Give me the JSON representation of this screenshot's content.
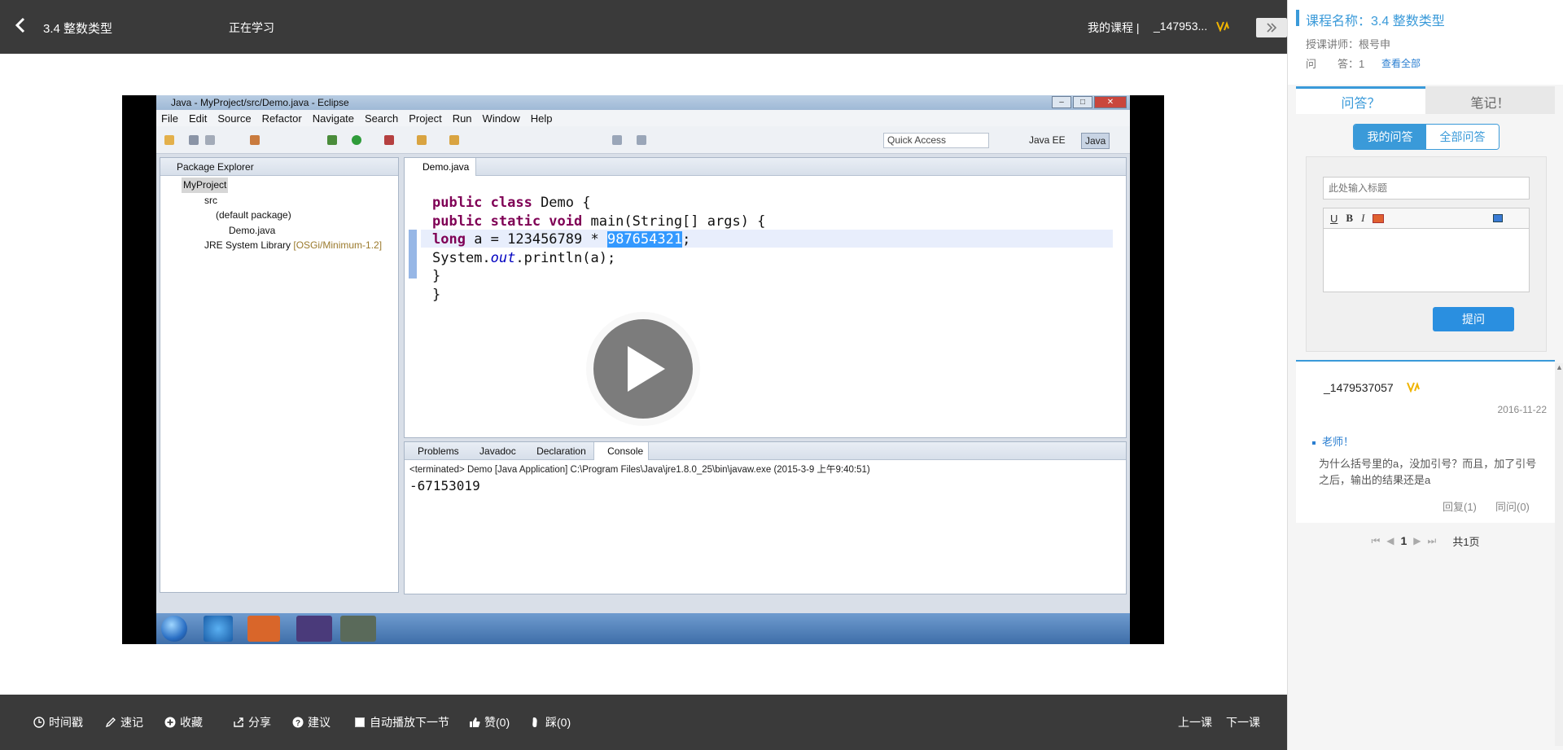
{
  "topbar": {
    "lesson_title": "3.4 整数类型",
    "status": "正在学习",
    "my_course": "我的课程 |",
    "username": "_147953..."
  },
  "video": {
    "eclipse_title": "Java - MyProject/src/Demo.java - Eclipse",
    "menu": [
      "File",
      "Edit",
      "Source",
      "Refactor",
      "Navigate",
      "Search",
      "Project",
      "Run",
      "Window",
      "Help"
    ],
    "quick_access": "Quick Access",
    "perspectives": [
      "Java EE",
      "Java"
    ],
    "package_explorer_title": "Package Explorer",
    "tree": {
      "project": "MyProject",
      "src": "src",
      "package": "(default package)",
      "file": "Demo.java",
      "jre": "JRE System Library",
      "jre_version": "[OSGi/Minimum-1.2]"
    },
    "editor_tab": "Demo.java",
    "code": {
      "line1_kw": "public class",
      "line1_rest": " Demo {",
      "line2_kw": "public static void",
      "line2_rest": " main(String[] args) {",
      "line3_kw": "long",
      "line3_mid": " a = 123456789 * ",
      "line3_sel": "987654321",
      "line3_end": ";",
      "line4_a": "System.",
      "line4_out": "out",
      "line4_b": ".println(a);",
      "line5": "}",
      "line6": "}"
    },
    "console_tabs": [
      "Problems",
      "Javadoc",
      "Declaration",
      "Console"
    ],
    "console_terminated": "<terminated> Demo [Java Application] C:\\Program Files\\Java\\jre1.8.0_25\\bin\\javaw.exe (2015-3-9 上午9:40:51)",
    "console_output": "-67153019"
  },
  "bottombar": {
    "timestamp": "时间戳",
    "quick_note": "速记",
    "favorite": "收藏",
    "share": "分享",
    "suggest": "建议",
    "autoplay": "自动播放下一节",
    "like": "赞(0)",
    "dislike": "踩(0)",
    "prev": "上一课",
    "next": "下一课"
  },
  "panel": {
    "course_name": "课程名称：3.4 整数类型",
    "teacher": "授课讲师：根号申",
    "qa_count": "问　　答：1",
    "view_all": "查看全部",
    "tab_qa": "问答？",
    "tab_notes": "笔记！",
    "seg_mine": "我的问答",
    "seg_all": "全部问答",
    "title_placeholder": "此处输入标题",
    "submit": "提问",
    "answer": {
      "user": "_1479537057",
      "date": "2016-11-22",
      "question": "老师！",
      "body": "为什么括号里的a，没加引号？而且，加了引号之后，输出的结果还是a",
      "reply": "回复(1)",
      "same": "同问(0)"
    },
    "pager": {
      "current": "1",
      "total": "共1页"
    }
  },
  "colors": {
    "accent": "#3a9ad9",
    "dark_bar": "#3a3a3a",
    "keyword": "#7f0055"
  }
}
